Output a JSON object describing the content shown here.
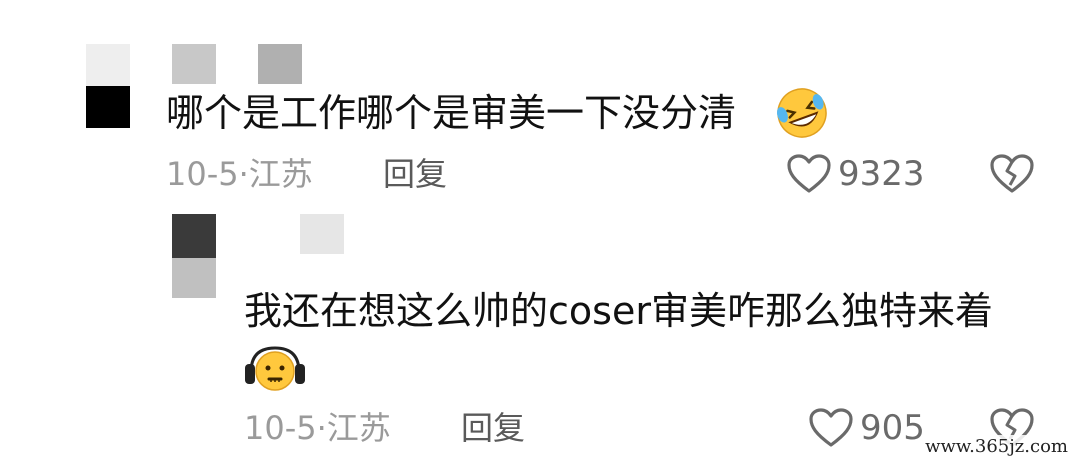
{
  "comments": [
    {
      "text": "哪个是工作哪个是审美一下没分清",
      "emoji": "rofl-emoji",
      "date": "10-5",
      "location": "江苏",
      "reply_label": "回复",
      "like_count": "9323"
    },
    {
      "text": "我还在想这么帅的coser审美咋那么独特来着",
      "emoji": "headphones-face-emoji",
      "date": "10-5",
      "location": "江苏",
      "reply_label": "回复",
      "like_count": "905"
    }
  ],
  "meta_separator": "·",
  "icons": {
    "like": "heart-outline-icon",
    "dislike": "broken-heart-icon"
  },
  "watermark": "www.365jz.com",
  "colors": {
    "text": "#111111",
    "meta": "#9a9a9a",
    "reply": "#5a5a5a",
    "icon": "#6a6a6a"
  }
}
